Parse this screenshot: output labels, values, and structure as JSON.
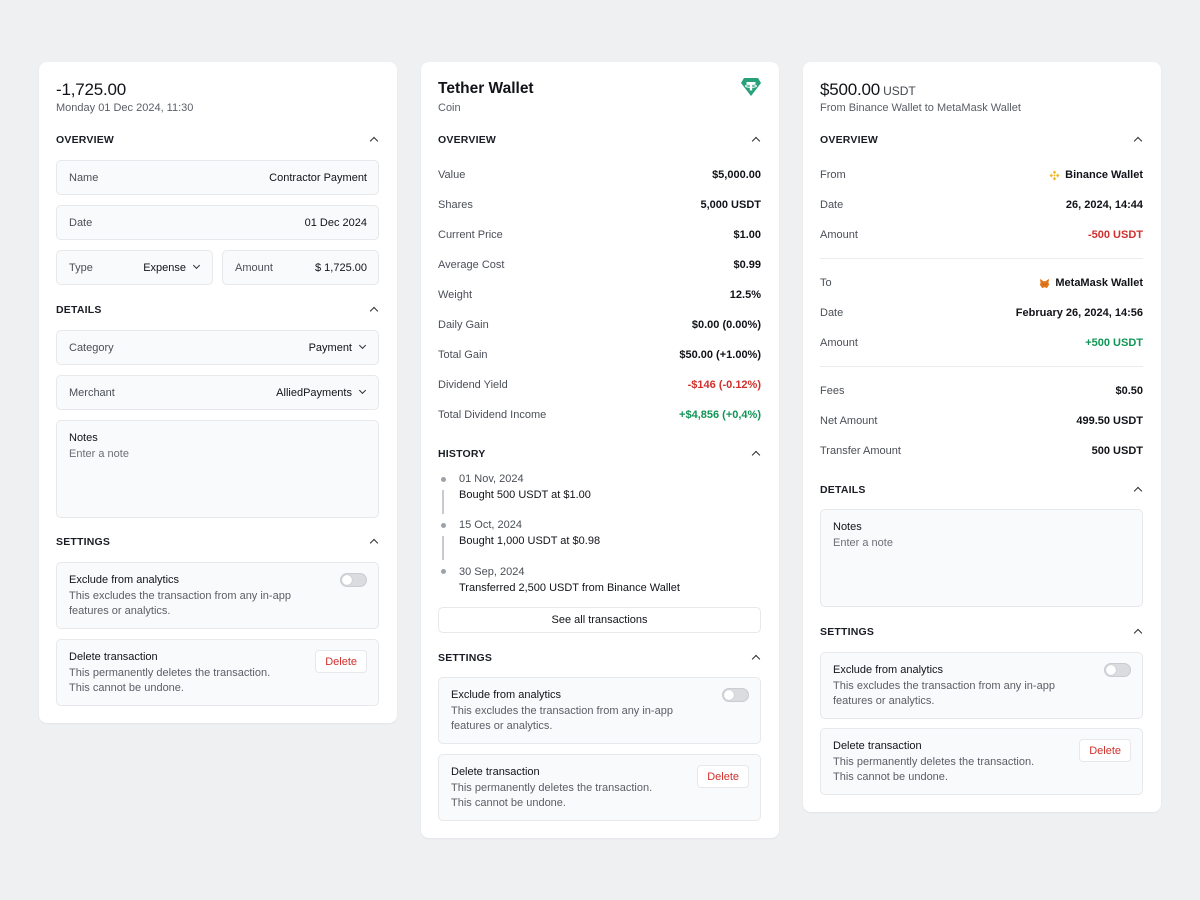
{
  "card1": {
    "amount": "-1,725.00",
    "datetime": "Monday 01 Dec 2024, 11:30",
    "overview": {
      "title": "OVERVIEW",
      "name_label": "Name",
      "name_value": "Contractor Payment",
      "date_label": "Date",
      "date_value": "01 Dec 2024",
      "type_label": "Type",
      "type_value": "Expense",
      "amount_label": "Amount",
      "amount_value": "$ 1,725.00"
    },
    "details": {
      "title": "DETAILS",
      "category_label": "Category",
      "category_value": "Payment",
      "merchant_label": "Merchant",
      "merchant_value": "AlliedPayments",
      "notes_label": "Notes",
      "notes_placeholder": "Enter a note"
    },
    "settings": {
      "title": "SETTINGS",
      "exclude_title": "Exclude from analytics",
      "exclude_desc_1": "This excludes the transaction from any in-app",
      "exclude_desc_2": "features or analytics.",
      "delete_title": "Delete transaction",
      "delete_desc_1": "This permanently deletes the transaction.",
      "delete_desc_2": "This cannot be undone.",
      "delete_button": "Delete"
    }
  },
  "card2": {
    "title": "Tether Wallet",
    "subtitle": "Coin",
    "icon": "tether-icon",
    "overview": {
      "title": "OVERVIEW",
      "rows": [
        {
          "label": "Value",
          "value": "$5,000.00",
          "tone": "normal"
        },
        {
          "label": "Shares",
          "value": "5,000 USDT",
          "tone": "normal"
        },
        {
          "label": "Current Price",
          "value": "$1.00",
          "tone": "normal"
        },
        {
          "label": "Average Cost",
          "value": "$0.99",
          "tone": "normal"
        },
        {
          "label": "Weight",
          "value": "12.5%",
          "tone": "normal"
        },
        {
          "label": "Daily Gain",
          "value": "$0.00 (0.00%)",
          "tone": "normal"
        },
        {
          "label": "Total Gain",
          "value": "$50.00 (+1.00%)",
          "tone": "normal"
        },
        {
          "label": "Dividend Yield",
          "value": "-$146 (-0.12%)",
          "tone": "negative"
        },
        {
          "label": "Total Dividend Income",
          "value": "+$4,856 (+0,4%)",
          "tone": "positive"
        }
      ]
    },
    "history": {
      "title": "HISTORY",
      "items": [
        {
          "date": "01 Nov, 2024",
          "text": "Bought 500 USDT at $1.00"
        },
        {
          "date": "15 Oct, 2024",
          "text": "Bought 1,000 USDT at $0.98"
        },
        {
          "date": "30 Sep, 2024",
          "text": "Transferred 2,500 USDT from Binance Wallet"
        }
      ],
      "see_all": "See all transactions"
    },
    "settings": {
      "title": "SETTINGS",
      "exclude_title": "Exclude from analytics",
      "exclude_desc_1": "This excludes the transaction from any in-app",
      "exclude_desc_2": "features or analytics.",
      "delete_title": "Delete transaction",
      "delete_desc_1": "This permanently deletes the transaction.",
      "delete_desc_2": "This cannot be undone.",
      "delete_button": "Delete"
    }
  },
  "card3": {
    "amount": "$500.00",
    "unit": "USDT",
    "subtitle": "From Binance Wallet to MetaMask Wallet",
    "overview": {
      "title": "OVERVIEW",
      "from_label": "From",
      "from_value": "Binance Wallet",
      "from_date_label": "Date",
      "from_date_value": "26, 2024, 14:44",
      "from_amount_label": "Amount",
      "from_amount_value": "-500 USDT",
      "to_label": "To",
      "to_value": "MetaMask Wallet",
      "to_date_label": "Date",
      "to_date_value": "February 26, 2024, 14:56",
      "to_amount_label": "Amount",
      "to_amount_value": "+500 USDT",
      "fees_label": "Fees",
      "fees_value": "$0.50",
      "net_label": "Net Amount",
      "net_value": "499.50 USDT",
      "transfer_label": "Transfer Amount",
      "transfer_value": "500 USDT"
    },
    "details": {
      "title": "DETAILS",
      "notes_label": "Notes",
      "notes_placeholder": "Enter a note"
    },
    "settings": {
      "title": "SETTINGS",
      "exclude_title": "Exclude from analytics",
      "exclude_desc_1": "This excludes the transaction from any in-app",
      "exclude_desc_2": "features or analytics.",
      "delete_title": "Delete transaction",
      "delete_desc_1": "This permanently deletes the transaction.",
      "delete_desc_2": "This cannot be undone.",
      "delete_button": "Delete"
    }
  },
  "colors": {
    "negative": "#d0302c",
    "positive": "#119556",
    "tether": "#26a17b",
    "binance": "#f3ba2f",
    "metamask": "#e2761b"
  }
}
